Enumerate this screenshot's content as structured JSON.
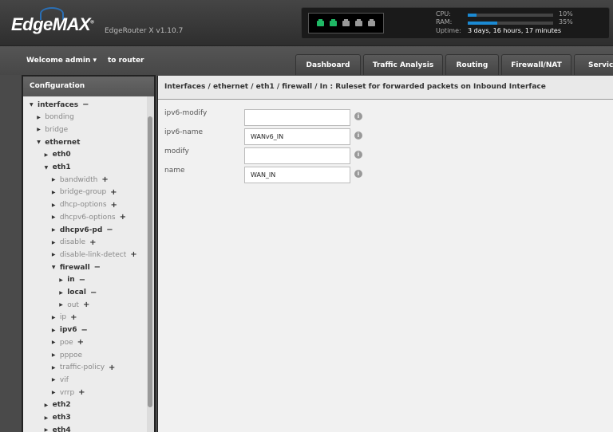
{
  "header": {
    "logo": "EdgeMAX",
    "model": "EdgeRouter X v1.10.7",
    "cpu_label": "CPU:",
    "cpu_pct": 10,
    "cpu_text": "10%",
    "ram_label": "RAM:",
    "ram_pct": 35,
    "ram_text": "35%",
    "uptime_label": "Uptime:",
    "uptime": "3 days, 16 hours, 17 minutes",
    "ports": [
      {
        "status": "up",
        "color": "#1fb865"
      },
      {
        "status": "up",
        "color": "#1fb865"
      },
      {
        "status": "down",
        "color": "#999999"
      },
      {
        "status": "down",
        "color": "#999999"
      },
      {
        "status": "down",
        "color": "#999999"
      }
    ]
  },
  "nav": {
    "welcome": "Welcome admin ▾",
    "to_router": "to router",
    "tabs": [
      "Dashboard",
      "Traffic Analysis",
      "Routing",
      "Firewall/NAT",
      "Services"
    ]
  },
  "sidebar": {
    "title": "Configuration",
    "items": [
      {
        "label": "interfaces",
        "level": 0,
        "open": true,
        "bold": true,
        "sign": "−"
      },
      {
        "label": "bonding",
        "level": 1,
        "open": false,
        "bold": false,
        "sign": ""
      },
      {
        "label": "bridge",
        "level": 1,
        "open": false,
        "bold": false,
        "sign": ""
      },
      {
        "label": "ethernet",
        "level": 1,
        "open": true,
        "bold": true,
        "sign": ""
      },
      {
        "label": "eth0",
        "level": 2,
        "open": false,
        "bold": true,
        "sign": ""
      },
      {
        "label": "eth1",
        "level": 2,
        "open": true,
        "bold": true,
        "sign": ""
      },
      {
        "label": "bandwidth",
        "level": 3,
        "open": false,
        "bold": false,
        "sign": "+"
      },
      {
        "label": "bridge-group",
        "level": 3,
        "open": false,
        "bold": false,
        "sign": "+"
      },
      {
        "label": "dhcp-options",
        "level": 3,
        "open": false,
        "bold": false,
        "sign": "+"
      },
      {
        "label": "dhcpv6-options",
        "level": 3,
        "open": false,
        "bold": false,
        "sign": "+"
      },
      {
        "label": "dhcpv6-pd",
        "level": 3,
        "open": false,
        "bold": true,
        "sign": "−"
      },
      {
        "label": "disable",
        "level": 3,
        "open": false,
        "bold": false,
        "sign": "+"
      },
      {
        "label": "disable-link-detect",
        "level": 3,
        "open": false,
        "bold": false,
        "sign": "+"
      },
      {
        "label": "firewall",
        "level": 3,
        "open": true,
        "bold": true,
        "sign": "−"
      },
      {
        "label": "in",
        "level": 4,
        "open": false,
        "bold": true,
        "sign": "−"
      },
      {
        "label": "local",
        "level": 4,
        "open": false,
        "bold": true,
        "sign": "−"
      },
      {
        "label": "out",
        "level": 4,
        "open": false,
        "bold": false,
        "sign": "+"
      },
      {
        "label": "ip",
        "level": 3,
        "open": false,
        "bold": false,
        "sign": "+"
      },
      {
        "label": "ipv6",
        "level": 3,
        "open": false,
        "bold": true,
        "sign": "−"
      },
      {
        "label": "poe",
        "level": 3,
        "open": false,
        "bold": false,
        "sign": "+"
      },
      {
        "label": "pppoe",
        "level": 3,
        "open": false,
        "bold": false,
        "sign": ""
      },
      {
        "label": "traffic-policy",
        "level": 3,
        "open": false,
        "bold": false,
        "sign": "+"
      },
      {
        "label": "vif",
        "level": 3,
        "open": false,
        "bold": false,
        "sign": ""
      },
      {
        "label": "vrrp",
        "level": 3,
        "open": false,
        "bold": false,
        "sign": "+"
      },
      {
        "label": "eth2",
        "level": 2,
        "open": false,
        "bold": true,
        "sign": ""
      },
      {
        "label": "eth3",
        "level": 2,
        "open": false,
        "bold": true,
        "sign": ""
      },
      {
        "label": "eth4",
        "level": 2,
        "open": false,
        "bold": true,
        "sign": ""
      }
    ]
  },
  "main": {
    "title": "Interfaces / ethernet / eth1 / firewall / In : Ruleset for forwarded packets on Inbound Interface",
    "fields": [
      {
        "label": "ipv6-modify",
        "value": ""
      },
      {
        "label": "ipv6-name",
        "value": "WANv6_IN"
      },
      {
        "label": "modify",
        "value": ""
      },
      {
        "label": "name",
        "value": "WAN_IN"
      }
    ]
  }
}
